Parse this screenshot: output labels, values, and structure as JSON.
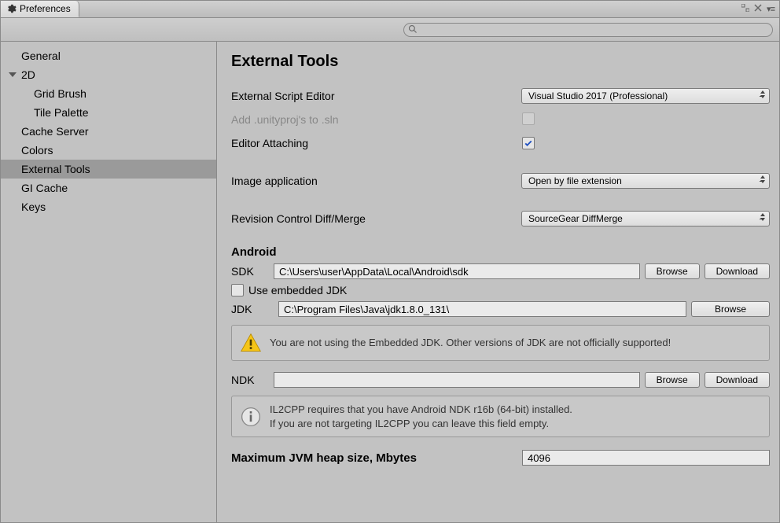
{
  "window": {
    "tab_title": "Preferences"
  },
  "search": {
    "placeholder": "",
    "value": ""
  },
  "sidebar": {
    "items": [
      {
        "label": "General",
        "depth": 0,
        "selected": false,
        "expandable": false
      },
      {
        "label": "2D",
        "depth": 0,
        "selected": false,
        "expandable": true,
        "expanded": true
      },
      {
        "label": "Grid Brush",
        "depth": 1,
        "selected": false,
        "expandable": false
      },
      {
        "label": "Tile Palette",
        "depth": 1,
        "selected": false,
        "expandable": false
      },
      {
        "label": "Cache Server",
        "depth": 0,
        "selected": false,
        "expandable": false
      },
      {
        "label": "Colors",
        "depth": 0,
        "selected": false,
        "expandable": false
      },
      {
        "label": "External Tools",
        "depth": 0,
        "selected": true,
        "expandable": false
      },
      {
        "label": "GI Cache",
        "depth": 0,
        "selected": false,
        "expandable": false
      },
      {
        "label": "Keys",
        "depth": 0,
        "selected": false,
        "expandable": false
      }
    ]
  },
  "page": {
    "title": "External Tools",
    "external_script_editor": {
      "label": "External Script Editor",
      "value": "Visual Studio 2017 (Professional)"
    },
    "add_unityproj": {
      "label": "Add .unityproj's to .sln",
      "checked": false,
      "disabled": true
    },
    "editor_attaching": {
      "label": "Editor Attaching",
      "checked": true
    },
    "image_application": {
      "label": "Image application",
      "value": "Open by file extension"
    },
    "revision_control": {
      "label": "Revision Control Diff/Merge",
      "value": "SourceGear DiffMerge"
    },
    "android": {
      "title": "Android",
      "sdk_label": "SDK",
      "sdk_path": "C:\\Users\\user\\AppData\\Local\\Android\\sdk",
      "use_embedded_jdk_label": "Use embedded JDK",
      "use_embedded_jdk_checked": false,
      "jdk_label": "JDK",
      "jdk_path": "C:\\Program Files\\Java\\jdk1.8.0_131\\",
      "jdk_warning": "You are not using the Embedded JDK. Other versions of JDK are not officially supported!",
      "ndk_label": "NDK",
      "ndk_path": "",
      "ndk_info": "IL2CPP requires that you have Android NDK r16b (64-bit) installed.\nIf you are not targeting IL2CPP you can leave this field empty.",
      "heap_label": "Maximum JVM heap size, Mbytes",
      "heap_value": "4096"
    },
    "buttons": {
      "browse": "Browse",
      "download": "Download"
    }
  }
}
